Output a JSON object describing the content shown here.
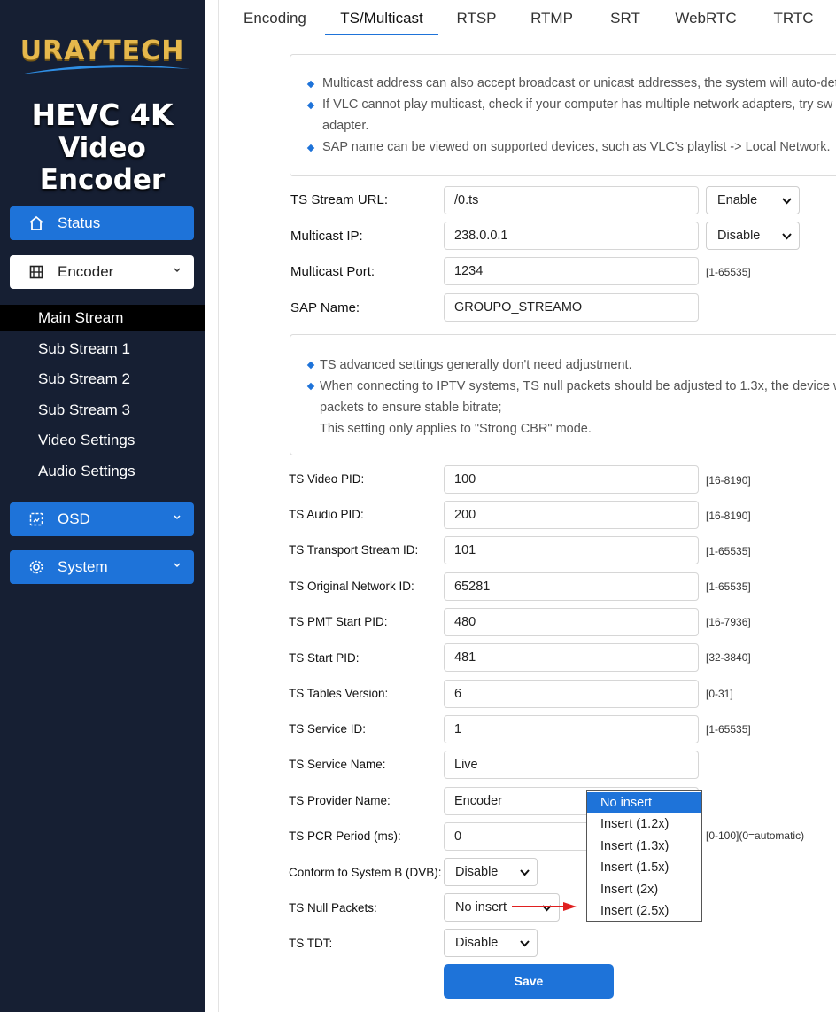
{
  "brand": {
    "name": "URAYTECH",
    "product_line1": "HEVC 4K",
    "product_line2": "Video Encoder"
  },
  "sidebar": {
    "status": {
      "label": "Status",
      "icon": "home-icon"
    },
    "encoder": {
      "label": "Encoder",
      "icon": "film-icon"
    },
    "encoder_items": [
      "Main Stream",
      "Sub Stream 1",
      "Sub Stream 2",
      "Sub Stream 3",
      "Video Settings",
      "Audio Settings"
    ],
    "active_item": "Main Stream",
    "osd": {
      "label": "OSD",
      "icon": "osd-icon"
    },
    "system": {
      "label": "System",
      "icon": "gear-icon"
    }
  },
  "tabs": [
    "Encoding",
    "TS/Multicast",
    "RTSP",
    "RTMP",
    "SRT",
    "WebRTC",
    "TRTC"
  ],
  "active_tab": "TS/Multicast",
  "notice1": {
    "lines": [
      "Multicast address can also accept broadcast or unicast addresses, the system will auto-det",
      "If VLC cannot play multicast, check if your computer has multiple network adapters, try sw",
      "adapter.",
      "SAP name can be viewed on supported devices, such as VLC's playlist -> Local Network."
    ]
  },
  "stream": {
    "url_label": "TS Stream URL:",
    "url_value": "/0.ts",
    "url_select": "Enable",
    "mcast_ip_label": "Multicast IP:",
    "mcast_ip_value": "238.0.0.1",
    "mcast_select": "Disable",
    "mcast_port_label": "Multicast Port:",
    "mcast_port_value": "1234",
    "mcast_port_range": "[1-65535]",
    "sap_label": "SAP Name:",
    "sap_value": "GROUPO_STREAMO"
  },
  "notice2": {
    "lines": [
      "TS advanced settings generally don't need adjustment.",
      "When connecting to IPTV systems, TS null packets should be adjusted to 1.3x, the device w",
      "packets to ensure stable bitrate;",
      "This setting only applies to \"Strong CBR\" mode."
    ]
  },
  "ts_fields": [
    {
      "label": "TS Video PID:",
      "value": "100",
      "range": "[16-8190]"
    },
    {
      "label": "TS Audio PID:",
      "value": "200",
      "range": "[16-8190]"
    },
    {
      "label": "TS Transport Stream ID:",
      "value": "101",
      "range": "[1-65535]"
    },
    {
      "label": "TS Original Network ID:",
      "value": "65281",
      "range": "[1-65535]"
    },
    {
      "label": "TS PMT Start PID:",
      "value": "480",
      "range": "[16-7936]"
    },
    {
      "label": "TS Start PID:",
      "value": "481",
      "range": "[32-3840]"
    },
    {
      "label": "TS Tables Version:",
      "value": "6",
      "range": "[0-31]"
    },
    {
      "label": "TS Service ID:",
      "value": "1",
      "range": "[1-65535]"
    },
    {
      "label": "TS Service Name:",
      "value": "Live",
      "range": ""
    },
    {
      "label": "TS Provider Name:",
      "value": "Encoder",
      "range": ""
    },
    {
      "label": "TS PCR Period (ms):",
      "value": "0",
      "range": "[0-100](0=automatic)"
    }
  ],
  "dvb": {
    "label": "Conform to System B (DVB):",
    "value": "Disable"
  },
  "null_packets": {
    "label": "TS Null Packets:",
    "value": "No insert",
    "options": [
      "No insert",
      "Insert (1.2x)",
      "Insert (1.3x)",
      "Insert (1.5x)",
      "Insert (2x)",
      "Insert (2.5x)"
    ],
    "highlighted": "No insert"
  },
  "tdt": {
    "label": "TS TDT:",
    "value": "Disable"
  },
  "save_label": "Save",
  "colors": {
    "sidebar_bg": "#161f33",
    "accent": "#1e73d9",
    "arrow": "#e02020"
  }
}
